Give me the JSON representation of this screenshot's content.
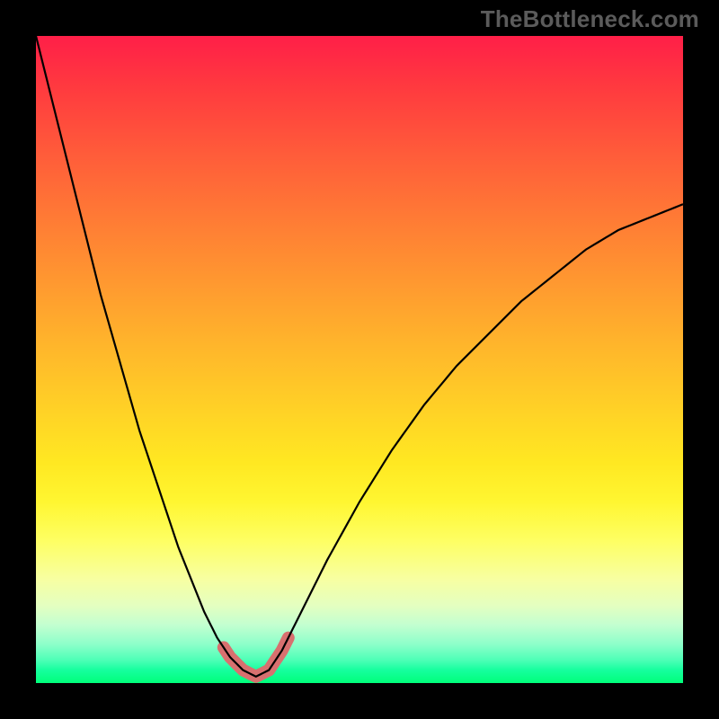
{
  "watermark": "TheBottleneck.com",
  "colors": {
    "gradient_top": "#ff1f48",
    "gradient_bottom": "#00ff7a",
    "curve": "#000000",
    "highlight": "#d8706f",
    "frame": "#000000"
  },
  "chart_data": {
    "type": "line",
    "title": "",
    "xlabel": "",
    "ylabel": "",
    "xlim": [
      0,
      100
    ],
    "ylim": [
      0,
      100
    ],
    "x": [
      0,
      2,
      4,
      6,
      8,
      10,
      12,
      14,
      16,
      18,
      20,
      22,
      24,
      26,
      28,
      30,
      32,
      34,
      36,
      38,
      40,
      45,
      50,
      55,
      60,
      65,
      70,
      75,
      80,
      85,
      90,
      95,
      100
    ],
    "values": [
      100,
      92,
      84,
      76,
      68,
      60,
      53,
      46,
      39,
      33,
      27,
      21,
      16,
      11,
      7,
      4,
      2,
      1,
      2,
      5,
      9,
      19,
      28,
      36,
      43,
      49,
      54,
      59,
      63,
      67,
      70,
      72,
      74
    ],
    "minimum": {
      "x": 34,
      "value": 1
    },
    "highlight_range": {
      "x_start": 29,
      "x_end": 39
    },
    "annotations": []
  }
}
